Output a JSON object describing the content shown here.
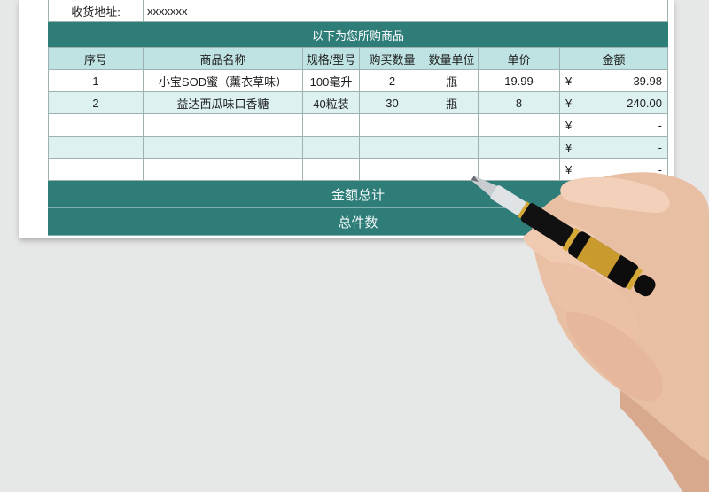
{
  "address": {
    "label": "收货地址:",
    "value": "xxxxxxx"
  },
  "banner": "以下为您所购商品",
  "columns": [
    "序号",
    "商品名称",
    "规格/型号",
    "购买数量",
    "数量单位",
    "单价",
    "金额"
  ],
  "rows": [
    {
      "no": "1",
      "name": "小宝SOD蜜（薰衣草味）",
      "spec": "100毫升",
      "qty": "2",
      "unit": "瓶",
      "price": "19.99",
      "currency": "¥",
      "amount": "39.98"
    },
    {
      "no": "2",
      "name": "益达西瓜味口香糖",
      "spec": "40粒装",
      "qty": "30",
      "unit": "瓶",
      "price": "8",
      "currency": "¥",
      "amount": "240.00"
    },
    {
      "no": "",
      "name": "",
      "spec": "",
      "qty": "",
      "unit": "",
      "price": "",
      "currency": "¥",
      "amount": "-"
    },
    {
      "no": "",
      "name": "",
      "spec": "",
      "qty": "",
      "unit": "",
      "price": "",
      "currency": "¥",
      "amount": "-"
    },
    {
      "no": "",
      "name": "",
      "spec": "",
      "qty": "",
      "unit": "",
      "price": "",
      "currency": "¥",
      "amount": "-"
    }
  ],
  "summary": {
    "total_label": "金额总计",
    "count_label": "总件数"
  },
  "colors": {
    "teal": "#2f7d78",
    "header": "#bfe3e2",
    "alt": "#ddf1f1",
    "background": "#e6e7e7"
  }
}
